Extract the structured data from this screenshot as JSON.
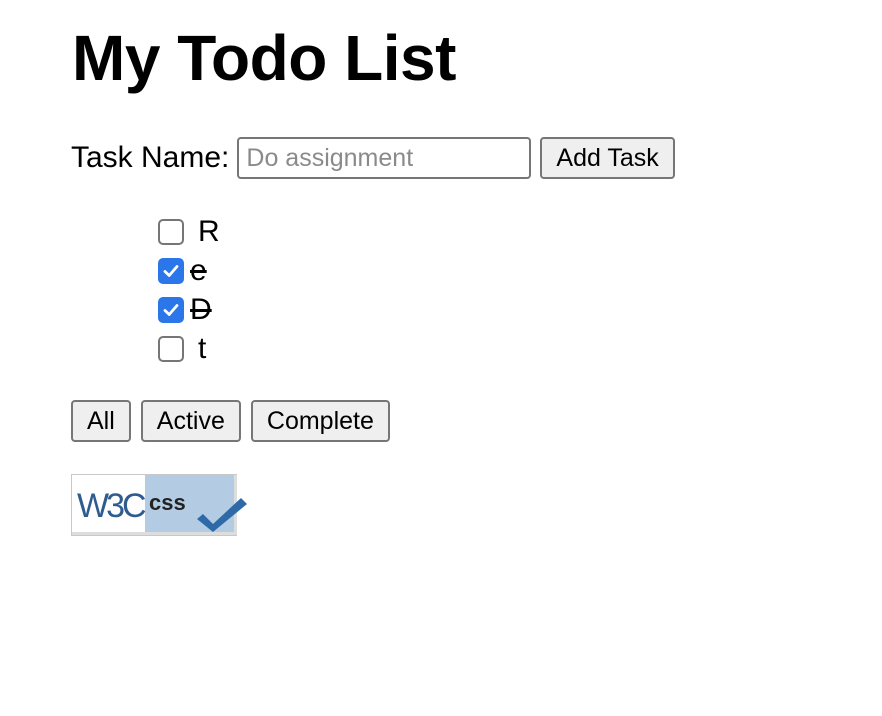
{
  "header": {
    "title": "My Todo List"
  },
  "form": {
    "label": "Task Name:",
    "input_value": "",
    "input_placeholder": "Do assignment",
    "add_button_label": "Add Task"
  },
  "tasks": [
    {
      "label": "R",
      "completed": false
    },
    {
      "label": "e",
      "completed": true
    },
    {
      "label": "D",
      "completed": true
    },
    {
      "label": "t",
      "completed": false
    }
  ],
  "filters": {
    "all_label": "All",
    "active_label": "Active",
    "complete_label": "Complete"
  },
  "badge": {
    "left_text": "W3C",
    "right_text": "css",
    "icon": "w3c-css-valid-badge"
  },
  "colors": {
    "checkbox_checked": "#2b76e9",
    "badge_right_bg": "#b3cce4",
    "badge_check": "#2f6aa8"
  }
}
